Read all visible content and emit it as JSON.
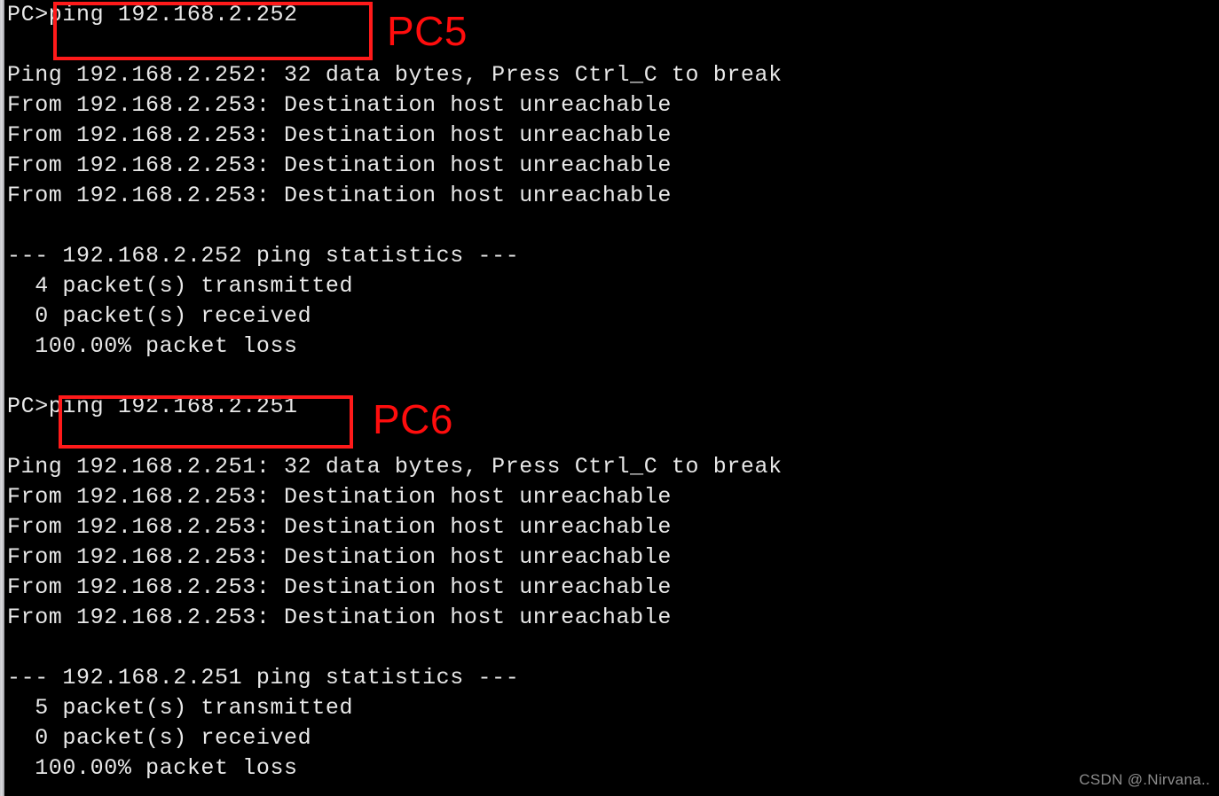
{
  "terminal": {
    "background_color": "#000000",
    "text_color": "#e8e8e8",
    "lines": [
      {
        "text": "PC>ping 192.168.2.252",
        "kind": "prompt"
      },
      {
        "text": "",
        "kind": "blank"
      },
      {
        "text": "Ping 192.168.2.252: 32 data bytes, Press Ctrl_C to break",
        "kind": "output"
      },
      {
        "text": "From 192.168.2.253: Destination host unreachable",
        "kind": "output"
      },
      {
        "text": "From 192.168.2.253: Destination host unreachable",
        "kind": "output"
      },
      {
        "text": "From 192.168.2.253: Destination host unreachable",
        "kind": "output"
      },
      {
        "text": "From 192.168.2.253: Destination host unreachable",
        "kind": "output"
      },
      {
        "text": "",
        "kind": "blank"
      },
      {
        "text": "--- 192.168.2.252 ping statistics ---",
        "kind": "output"
      },
      {
        "text": "  4 packet(s) transmitted",
        "kind": "output"
      },
      {
        "text": "  0 packet(s) received",
        "kind": "output"
      },
      {
        "text": "  100.00% packet loss",
        "kind": "output"
      },
      {
        "text": "",
        "kind": "blank"
      },
      {
        "text": "PC>ping 192.168.2.251",
        "kind": "prompt"
      },
      {
        "text": "",
        "kind": "blank"
      },
      {
        "text": "Ping 192.168.2.251: 32 data bytes, Press Ctrl_C to break",
        "kind": "output"
      },
      {
        "text": "From 192.168.2.253: Destination host unreachable",
        "kind": "output"
      },
      {
        "text": "From 192.168.2.253: Destination host unreachable",
        "kind": "output"
      },
      {
        "text": "From 192.168.2.253: Destination host unreachable",
        "kind": "output"
      },
      {
        "text": "From 192.168.2.253: Destination host unreachable",
        "kind": "output"
      },
      {
        "text": "From 192.168.2.253: Destination host unreachable",
        "kind": "output"
      },
      {
        "text": "",
        "kind": "blank"
      },
      {
        "text": "--- 192.168.2.251 ping statistics ---",
        "kind": "output"
      },
      {
        "text": "  5 packet(s) transmitted",
        "kind": "output"
      },
      {
        "text": "  0 packet(s) received",
        "kind": "output"
      },
      {
        "text": "  100.00% packet loss",
        "kind": "output"
      }
    ]
  },
  "annotations": {
    "color": "#ff0d0d",
    "items": [
      {
        "label": "PC5",
        "highlights_command": "ping 192.168.2.252",
        "target_host": "192.168.2.252"
      },
      {
        "label": "PC6",
        "highlights_command": "ping 192.168.2.251",
        "target_host": "192.168.2.251"
      }
    ]
  },
  "sessions": [
    {
      "pc": "PC5",
      "command": "ping 192.168.2.252",
      "prompt": "PC>",
      "target": "192.168.2.252",
      "data_bytes": "32",
      "break_key": "Ctrl_C",
      "reply_from": "192.168.2.253",
      "reply_message": "Destination host unreachable",
      "reply_count": 4,
      "packets_transmitted": "4",
      "packets_received": "0",
      "packet_loss": "100.00%"
    },
    {
      "pc": "PC6",
      "command": "ping 192.168.2.251",
      "prompt": "PC>",
      "target": "192.168.2.251",
      "data_bytes": "32",
      "break_key": "Ctrl_C",
      "reply_from": "192.168.2.253",
      "reply_message": "Destination host unreachable",
      "reply_count": 5,
      "packets_transmitted": "5",
      "packets_received": "0",
      "packet_loss": "100.00%"
    }
  ],
  "watermark": {
    "text": "CSDN @.Nirvana.."
  }
}
